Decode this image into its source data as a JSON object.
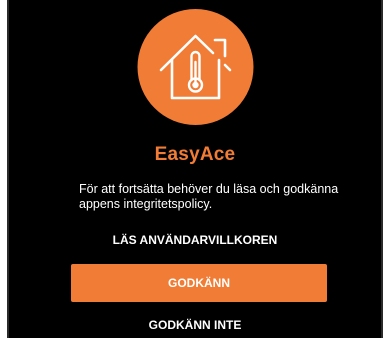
{
  "app": {
    "name": "EasyAce",
    "logo_icon": "house-thermometer-icon",
    "accent_color": "#f07c35",
    "background_color": "#000000"
  },
  "consent": {
    "message": "För att fortsätta behöver du läsa och godkänna appens integritetspolicy.",
    "read_terms_label": "LÄS ANVÄNDARVILLKOREN",
    "accept_label": "GODKÄNN",
    "decline_label": "GODKÄNN INTE"
  }
}
